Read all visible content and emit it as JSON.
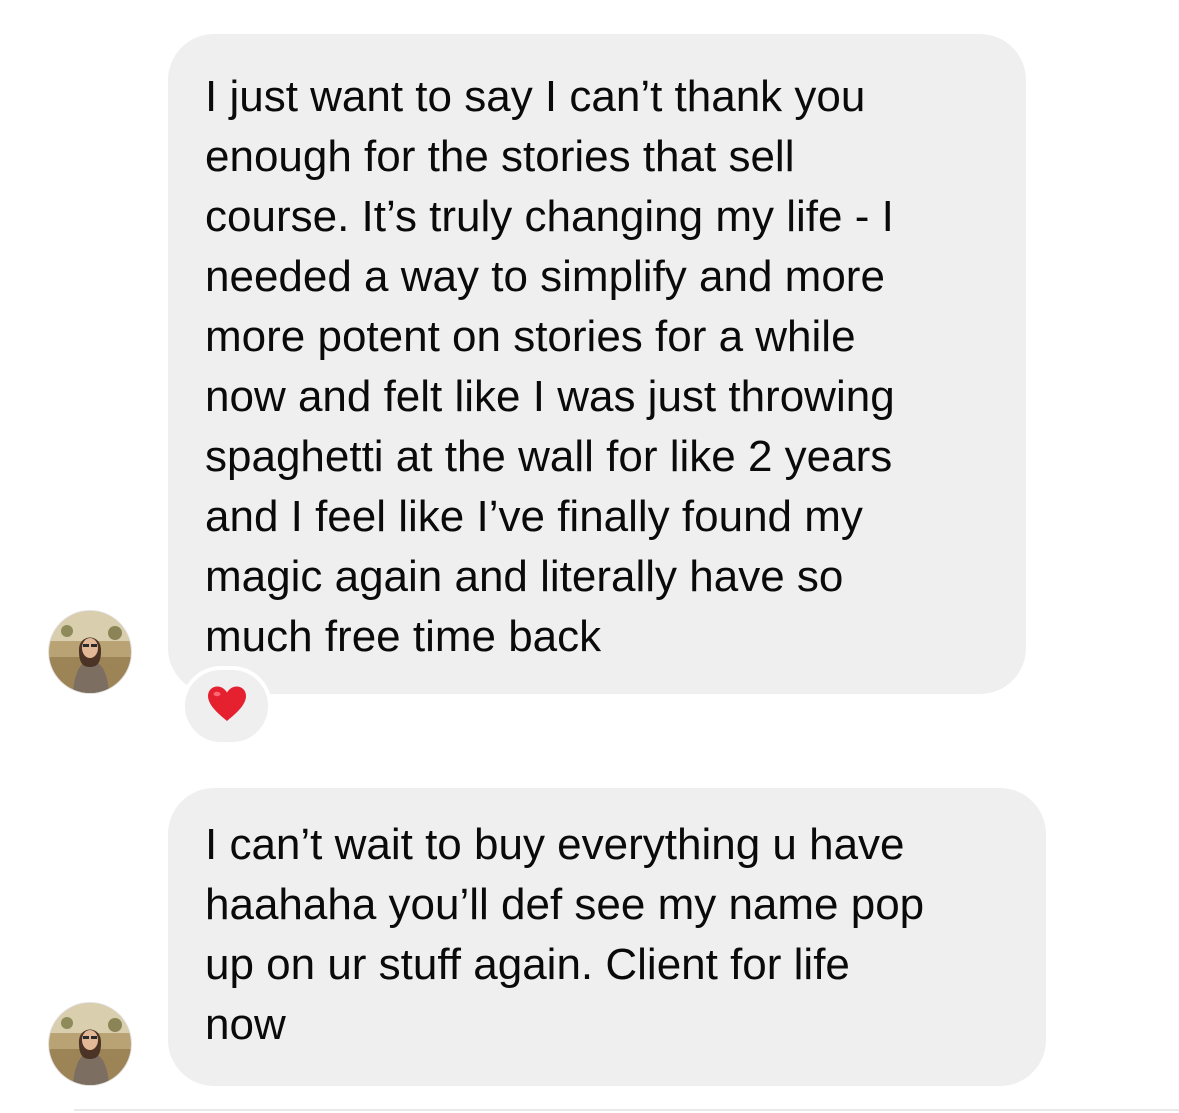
{
  "thread": {
    "messages": [
      {
        "sender": "incoming",
        "lines": [
          "I just want to say I can’t thank you",
          "enough for the stories that sell",
          "course. It’s truly changing my life - I",
          "needed a way to simplify and more",
          "more potent on stories for a while",
          "now and felt like I was just throwing",
          "spaghetti at the wall for like 2 years",
          "and I feel like I’ve finally found my",
          "magic again and literally have so",
          "much free time back"
        ],
        "reaction": {
          "emoji": "❤️",
          "icon": "heart-icon"
        }
      },
      {
        "sender": "incoming",
        "lines": [
          "I can’t wait to buy everything u have",
          "haahaha you’ll def see my name pop",
          "up on ur stuff again. Client for life",
          "now"
        ]
      }
    ]
  },
  "colors": {
    "bubble_background": "#efefef",
    "text": "#0a0a0a",
    "heart": "#e5202f",
    "page_background": "#ffffff"
  }
}
